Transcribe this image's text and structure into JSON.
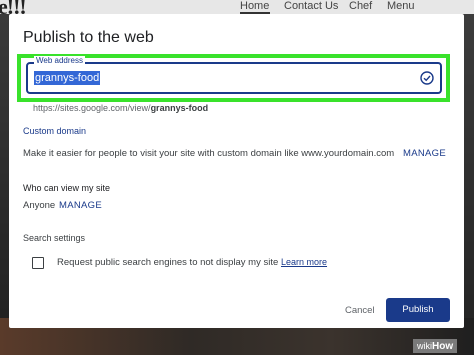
{
  "background": {
    "logo_text": "e!!!",
    "nav": [
      "Home",
      "Contact Us",
      "Chef",
      "Menu"
    ]
  },
  "dialog": {
    "title": "Publish to the web",
    "web_address": {
      "label": "Web address",
      "value": "grannys-food"
    },
    "url_prefix": "https://sites.google.com/view/",
    "url_slug": "grannys-food",
    "custom_domain": {
      "title": "Custom domain",
      "description": "Make it easier for people to visit your site with custom domain like www.yourdomain.com",
      "manage": "MANAGE"
    },
    "who_can_view": {
      "title": "Who can view my site",
      "value": "Anyone",
      "manage": "MANAGE"
    },
    "search_settings": {
      "title": "Search settings",
      "checkbox_label": "Request public search engines to not display my site",
      "learn_more": "Learn more"
    },
    "cancel": "Cancel",
    "publish": "Publish"
  },
  "colors": {
    "accent": "#1a3a8a",
    "highlight": "#39e22b",
    "selection": "#3367d6"
  },
  "watermark": {
    "wiki": "wiki",
    "how": "How"
  }
}
